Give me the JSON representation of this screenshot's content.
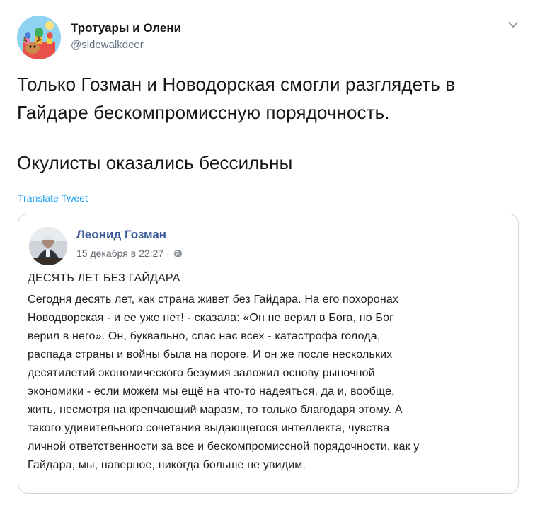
{
  "tweet": {
    "author_name": "Тротуары и Олени",
    "author_handle": "@sidewalkdeer",
    "text_line_1": "Только Гозман и Новодорская смогли разглядеть в",
    "text_line_2": "Гайдаре бескомпромиссную порядочность.",
    "text_line_3": "Окулисты оказались бессильны",
    "translate_label": "Translate Tweet",
    "menu_icon": "chevron-down-icon"
  },
  "embedded_post": {
    "author_name": "Леонид Гозман",
    "date": "15 декабря в 22:27",
    "separator": "·",
    "privacy_icon": "globe-icon",
    "headline": "ДЕСЯТЬ ЛЕТ БЕЗ ГАЙДАРА",
    "body_lines": [
      "Сегодня десять лет, как страна живет без Гайдара. На его похоронах",
      "Новодворская - и ее уже нет! - сказала: «Он не верил в Бога, но Бог",
      "верил в него». Он, буквально, спас нас всех - катастрофа голода,",
      "распада страны и войны была на пороге. И он же после нескольких",
      "десятилетий экономического безумия заложил основу рыночной",
      "экономики - если можем мы ещё на что-то надеяться, да и, вообще,",
      "жить, несмотря на крепчающий маразм, то только благодаря этому. А",
      "такого удивительного сочетания выдающегося интеллекта, чувства",
      "личной ответственности за все и бескомпромиссной порядочности, как у",
      "Гайдара, мы, наверное, никогда больше не увидим."
    ]
  }
}
